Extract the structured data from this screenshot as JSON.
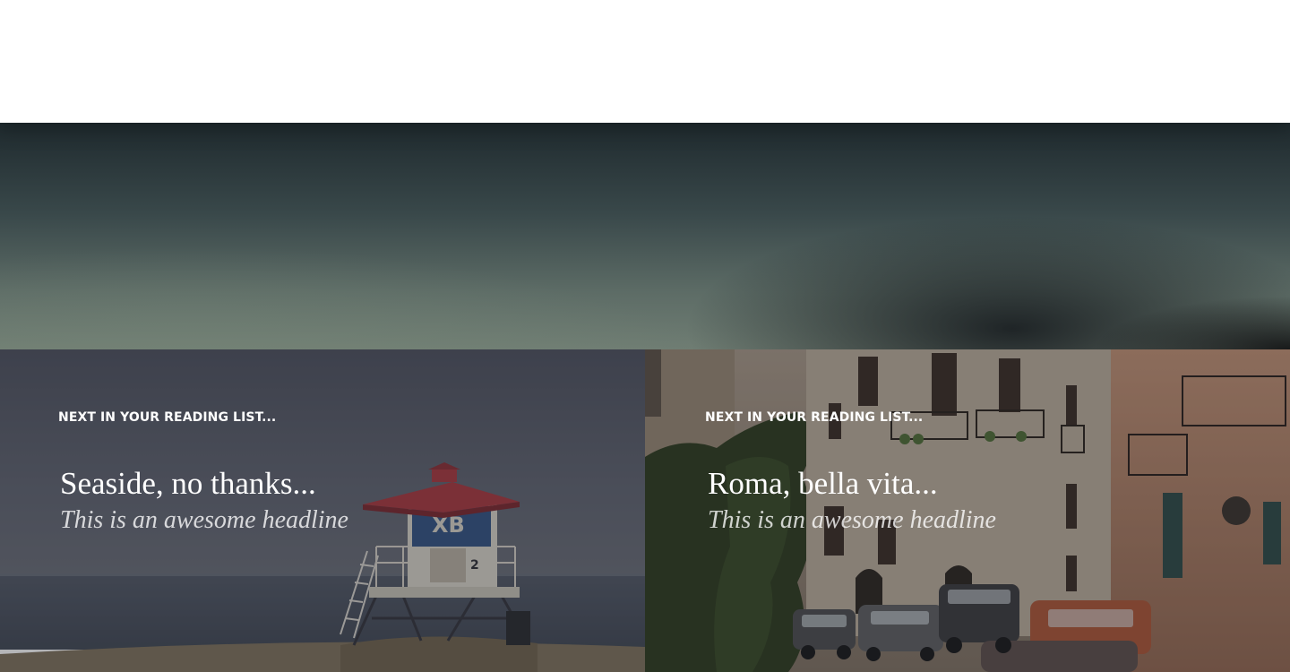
{
  "cards": [
    {
      "kicker": "NEXT IN YOUR READING LIST...",
      "title": "Seaside, no thanks...",
      "subtitle": "This is an awesome headline",
      "tower_label": "XB",
      "tower_number": "2"
    },
    {
      "kicker": "NEXT IN YOUR READING LIST...",
      "title": "Roma, bella vita...",
      "subtitle": "This is an awesome headline"
    }
  ]
}
